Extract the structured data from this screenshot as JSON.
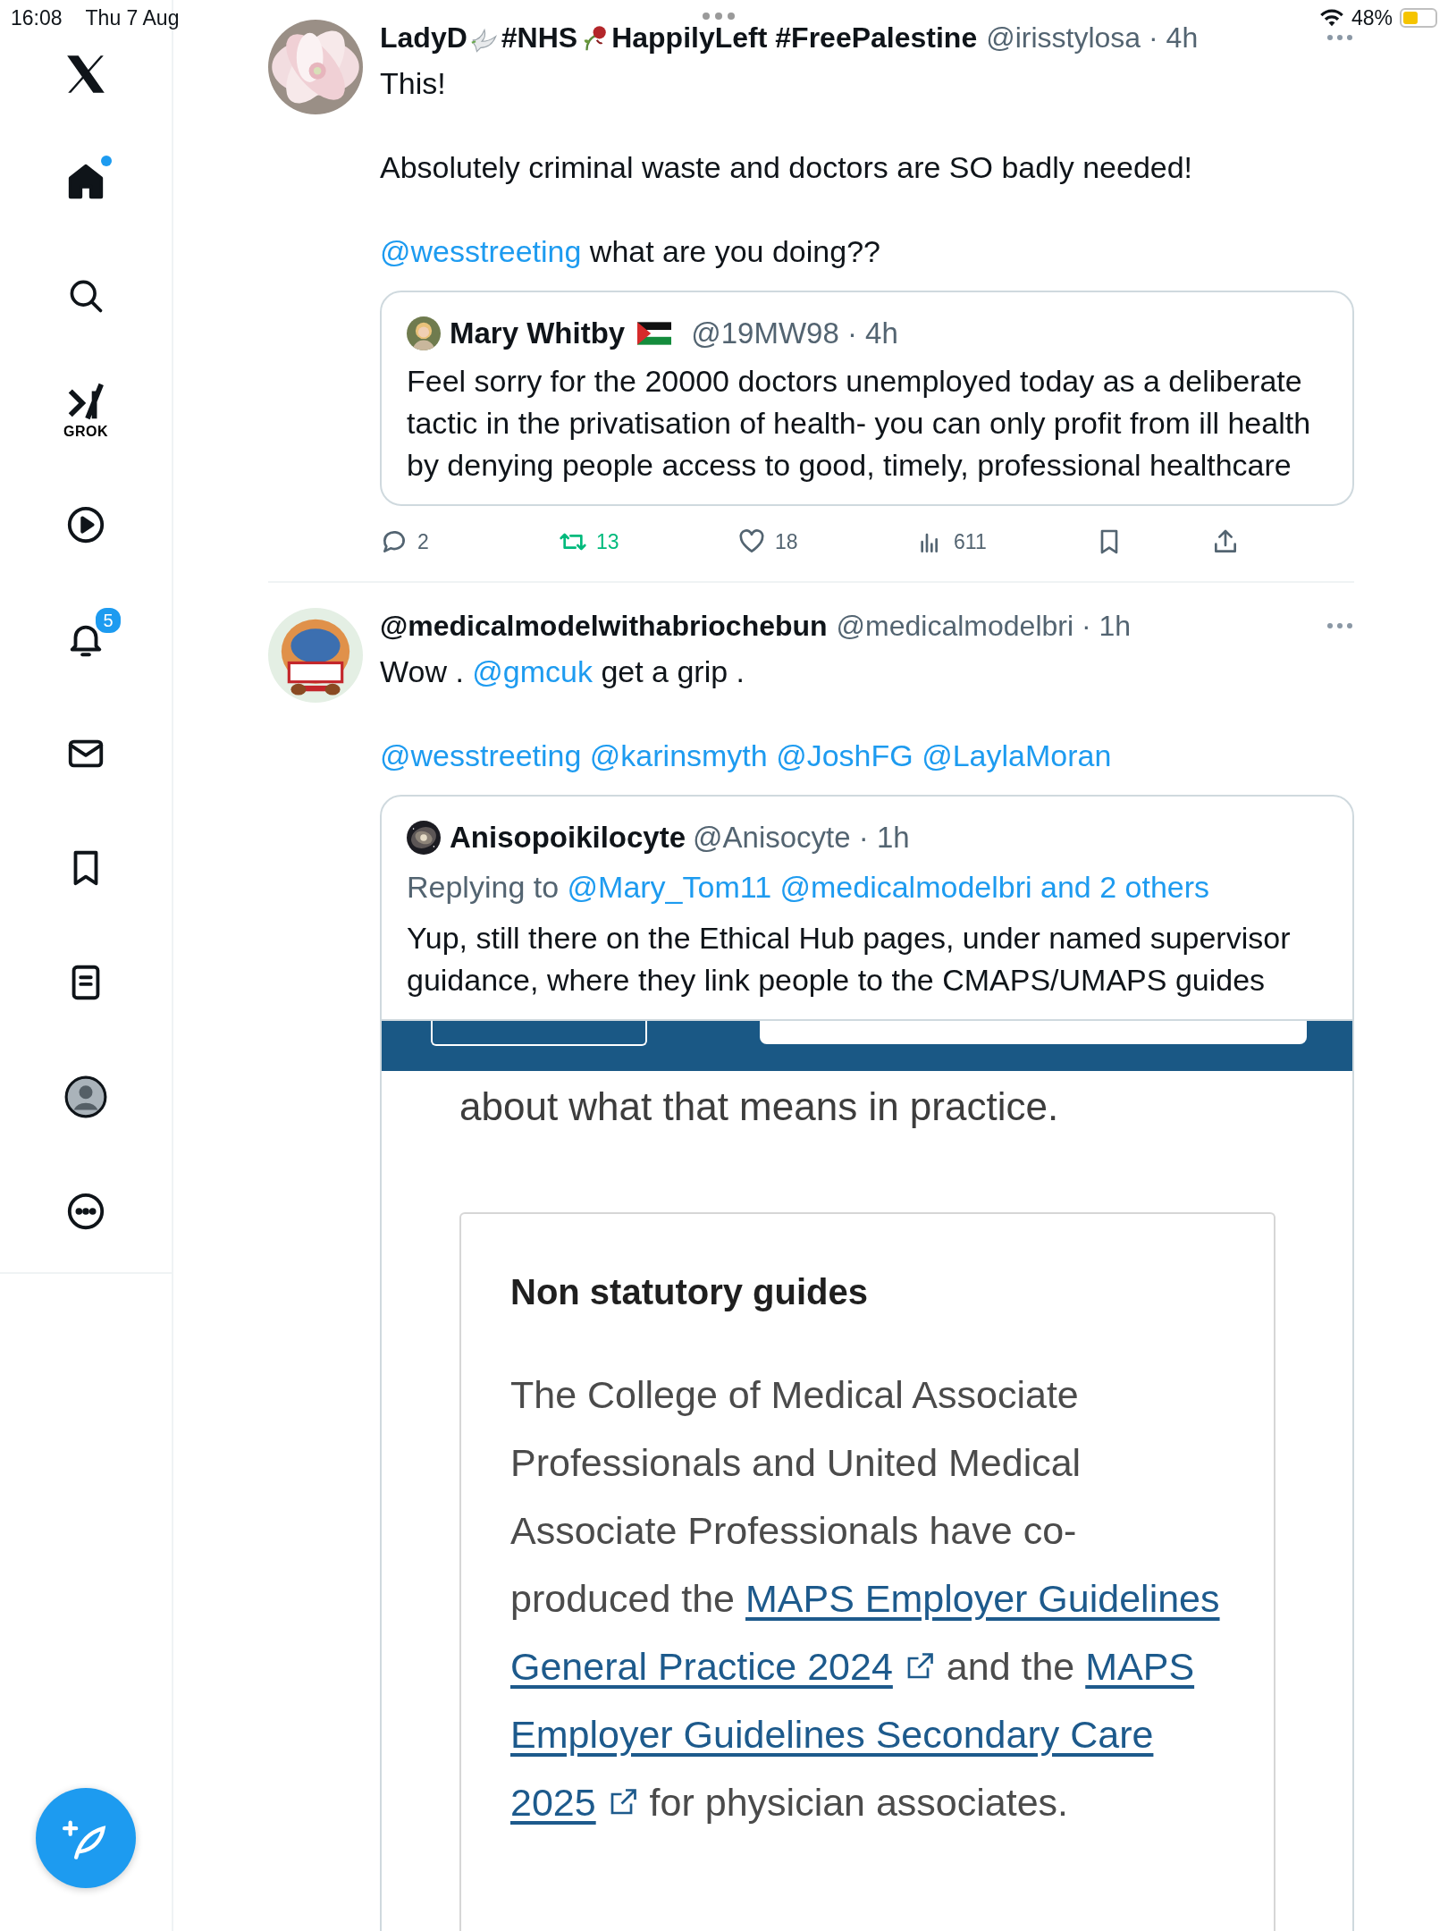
{
  "status_bar": {
    "time": "16:08",
    "date": "Thu 7 Aug",
    "battery": "48%"
  },
  "sidebar": {
    "items": [
      {
        "kind": "logo"
      },
      {
        "kind": "home",
        "selected": true,
        "dot": true
      },
      {
        "kind": "search",
        "selected": false
      },
      {
        "kind": "grok",
        "label": "GROK",
        "selected": false
      },
      {
        "kind": "video",
        "selected": false
      },
      {
        "kind": "notifications",
        "badge": "5",
        "selected": false
      },
      {
        "kind": "messages",
        "selected": false
      },
      {
        "kind": "bookmarks",
        "selected": false
      },
      {
        "kind": "lists",
        "selected": false
      },
      {
        "kind": "profile",
        "selected": false
      },
      {
        "kind": "more",
        "selected": false
      }
    ]
  },
  "tweets": [
    {
      "name": [
        {
          "kind": "text",
          "text": "LadyD"
        },
        {
          "kind": "dove"
        },
        {
          "kind": "text",
          "text": "#NHS"
        },
        {
          "kind": "rose"
        },
        {
          "kind": "text",
          "text": "HappilyLeft #FreePalestine"
        }
      ],
      "meta": "@irisstylosa · 4h",
      "body": [
        [
          {
            "kind": "text",
            "text": "This!"
          }
        ],
        [
          {
            "kind": "text",
            "text": "Absolutely criminal waste and doctors are SO badly needed!"
          }
        ],
        [
          {
            "kind": "mention",
            "text": "@wesstreeting"
          },
          {
            "kind": "text",
            "text": " what are you doing??"
          }
        ]
      ],
      "quote": {
        "name": [
          {
            "kind": "text",
            "text": "Mary Whitby"
          },
          {
            "kind": "flag"
          }
        ],
        "meta": "@19MW98 · 4h",
        "body": [
          [
            {
              "kind": "text",
              "text": "Feel sorry for the 20000 doctors unemployed today as a deliberate tactic in the privatisation of health- you can only profit from ill health by denying people access to good, timely, professional healthcare"
            }
          ]
        ]
      },
      "actions": [
        {
          "kind": "reply",
          "count": "2",
          "active": false
        },
        {
          "kind": "repost",
          "count": "13",
          "active": true
        },
        {
          "kind": "like",
          "count": "18",
          "active": false
        },
        {
          "kind": "views",
          "count": "611",
          "active": false
        },
        {
          "kind": "bookmark",
          "active": false
        },
        {
          "kind": "share",
          "active": false
        }
      ]
    },
    {
      "name": [
        {
          "kind": "text",
          "text": "@medicalmodelwithabriochebun"
        }
      ],
      "meta": "@medicalmodelbri · 1h",
      "body": [
        [
          {
            "kind": "text",
            "text": "Wow . "
          },
          {
            "kind": "mention",
            "text": "@gmcuk"
          },
          {
            "kind": "text",
            "text": " get a grip ."
          }
        ],
        [
          {
            "kind": "mention",
            "text": "@wesstreeting @karinsmyth @JoshFG @LaylaMoran"
          }
        ]
      ],
      "quote": {
        "name": [
          {
            "kind": "text",
            "text": "Anisopoikilocyte"
          }
        ],
        "meta": "@Anisocyte · 1h",
        "replying": [
          {
            "kind": "text",
            "text": "Replying to "
          },
          {
            "kind": "mention",
            "text": "@Mary_Tom11 @medicalmodelbri and 2 others"
          }
        ],
        "body": [
          [
            {
              "kind": "text",
              "text": "Yup, still there on the Ethical Hub pages, under named supervisor guidance, where they link people to the CMAPS/UMAPS guides"
            }
          ]
        ],
        "screenshot": {
          "intro": "about what that means in practice.",
          "heading": "Non statutory guides",
          "lines": [
            [
              {
                "kind": "text",
                "text": "The College of Medical Associate"
              }
            ],
            [
              {
                "kind": "text",
                "text": "Professionals and United Medical"
              }
            ],
            [
              {
                "kind": "text",
                "text": "Associate Professionals have co-"
              }
            ],
            [
              {
                "kind": "text",
                "text": "produced the "
              },
              {
                "kind": "link",
                "text": "MAPS Employer Guidelines"
              }
            ],
            [
              {
                "kind": "link",
                "text": "General Practice 2024"
              },
              {
                "kind": "ext"
              },
              {
                "kind": "text",
                "text": " and the "
              },
              {
                "kind": "link",
                "text": "MAPS"
              }
            ],
            [
              {
                "kind": "link",
                "text": "Employer Guidelines Secondary Care"
              }
            ],
            [
              {
                "kind": "link",
                "text": "2025"
              },
              {
                "kind": "ext"
              },
              {
                "kind": "text",
                "text": " for physician associates."
              }
            ]
          ]
        }
      }
    }
  ]
}
